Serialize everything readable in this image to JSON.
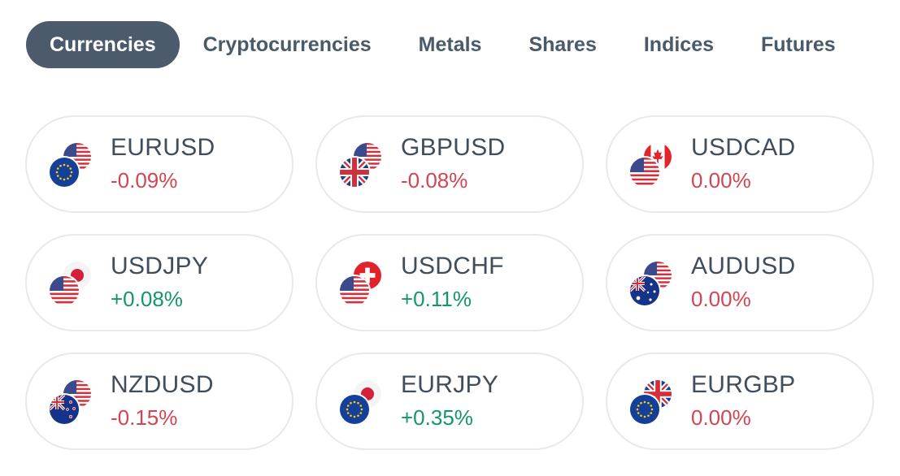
{
  "tabs": [
    {
      "label": "Currencies",
      "active": true
    },
    {
      "label": "Cryptocurrencies",
      "active": false
    },
    {
      "label": "Metals",
      "active": false
    },
    {
      "label": "Shares",
      "active": false
    },
    {
      "label": "Indices",
      "active": false
    },
    {
      "label": "Futures",
      "active": false
    }
  ],
  "pairs": [
    {
      "symbol": "EURUSD",
      "change": "-0.09%",
      "direction": "negative",
      "flags": [
        "us-flag-icon",
        "eu-flag-icon"
      ]
    },
    {
      "symbol": "GBPUSD",
      "change": "-0.08%",
      "direction": "negative",
      "flags": [
        "us-flag-icon",
        "uk-flag-icon"
      ]
    },
    {
      "symbol": "USDCAD",
      "change": "0.00%",
      "direction": "negative",
      "flags": [
        "ca-flag-icon",
        "us-flag-icon"
      ]
    },
    {
      "symbol": "USDJPY",
      "change": "+0.08%",
      "direction": "positive",
      "flags": [
        "jp-flag-icon",
        "us-flag-icon"
      ]
    },
    {
      "symbol": "USDCHF",
      "change": "+0.11%",
      "direction": "positive",
      "flags": [
        "ch-flag-icon",
        "us-flag-icon"
      ]
    },
    {
      "symbol": "AUDUSD",
      "change": "0.00%",
      "direction": "negative",
      "flags": [
        "us-flag-icon",
        "au-flag-icon"
      ]
    },
    {
      "symbol": "NZDUSD",
      "change": "-0.15%",
      "direction": "negative",
      "flags": [
        "us-flag-icon",
        "nz-flag-icon"
      ]
    },
    {
      "symbol": "EURJPY",
      "change": "+0.35%",
      "direction": "positive",
      "flags": [
        "jp-flag-icon",
        "eu-flag-icon"
      ]
    },
    {
      "symbol": "EURGBP",
      "change": "0.00%",
      "direction": "negative",
      "flags": [
        "uk-flag-icon",
        "eu-flag-icon"
      ]
    }
  ],
  "colors": {
    "negative": "#d24552",
    "positive": "#14956e",
    "tab_active_bg": "#4b5b6c",
    "text": "#404d5b"
  }
}
